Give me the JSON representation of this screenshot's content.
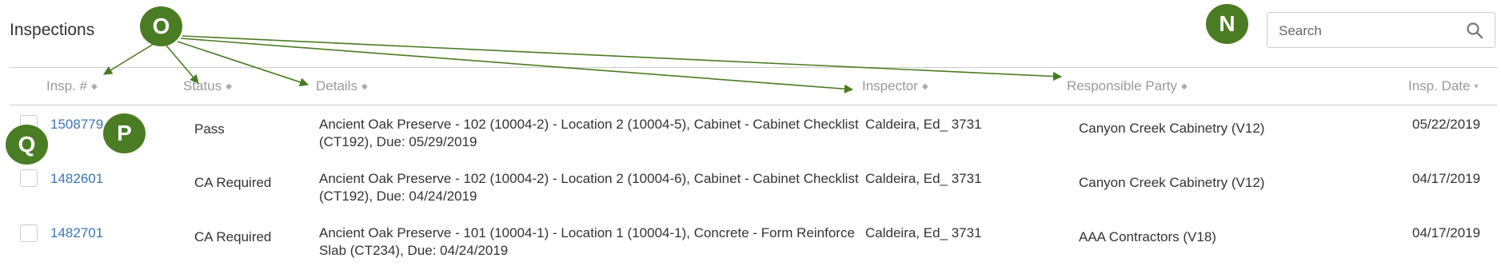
{
  "page": {
    "title": "Inspections"
  },
  "search": {
    "placeholder": "Search",
    "value": ""
  },
  "columns": {
    "insp_no": "Insp. #",
    "status": "Status",
    "details": "Details",
    "inspector": "Inspector",
    "responsible_party": "Responsible Party",
    "insp_date": "Insp. Date"
  },
  "rows": [
    {
      "insp_no": "1508779",
      "status": "Pass",
      "details": "Ancient Oak Preserve - 102 (10004-2) - Location 2 (10004-5), Cabinet - Cabinet Checklist (CT192), Due: 05/29/2019",
      "inspector": "Caldeira, Ed_ 3731",
      "responsible_party": "Canyon Creek Cabinetry (V12)",
      "insp_date": "05/22/2019"
    },
    {
      "insp_no": "1482601",
      "status": "CA Required",
      "details": "Ancient Oak Preserve - 102 (10004-2) - Location 2 (10004-6), Cabinet - Cabinet Checklist (CT192), Due: 04/24/2019",
      "inspector": "Caldeira, Ed_ 3731",
      "responsible_party": "Canyon Creek Cabinetry (V12)",
      "insp_date": "04/17/2019"
    },
    {
      "insp_no": "1482701",
      "status": "CA Required",
      "details": "Ancient Oak Preserve - 101 (10004-1) - Location 1 (10004-1), Concrete - Form Reinforce Slab (CT234), Due: 04/24/2019",
      "inspector": "Caldeira, Ed_ 3731",
      "responsible_party": "AAA Contractors (V18)",
      "insp_date": "04/17/2019"
    }
  ],
  "annotations": {
    "n": "N",
    "o": "O",
    "p": "P",
    "q": "Q",
    "color": "#4a7c23"
  }
}
